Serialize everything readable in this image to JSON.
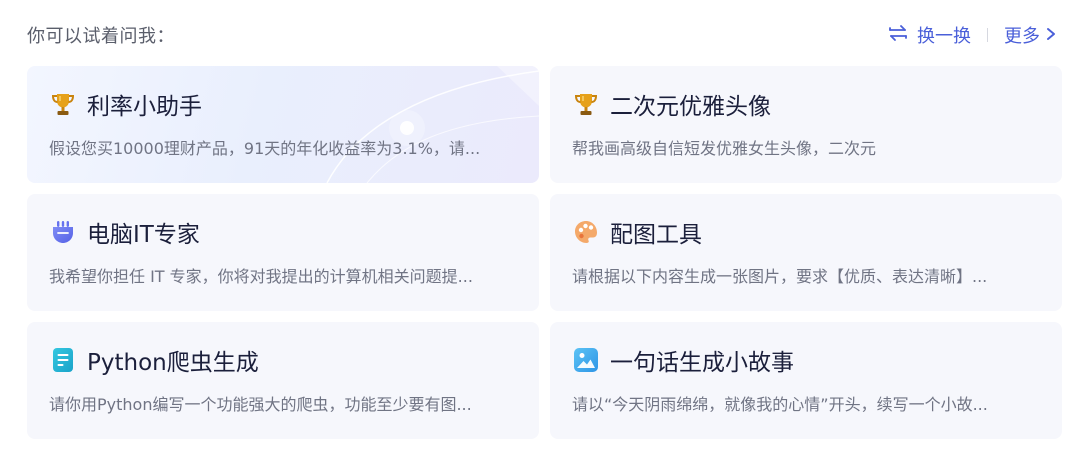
{
  "header": {
    "prompt": "你可以试着问我：",
    "swap_label": "换一换",
    "more_label": "更多"
  },
  "colors": {
    "accent": "#4a5fd9",
    "title": "#1b1f3b",
    "desc": "#707484",
    "card_bg": "#f6f7fc"
  },
  "cards": [
    {
      "icon": "trophy-icon",
      "title": "利率小助手",
      "desc": "假设您买10000理财产品，91天的年化收益率为3.1%，请..."
    },
    {
      "icon": "trophy-icon",
      "title": "二次元优雅头像",
      "desc": "帮我画高级自信短发优雅女生头像，二次元"
    },
    {
      "icon": "plug-icon",
      "title": "电脑IT专家",
      "desc": "我希望你担任 IT 专家，你将对我提出的计算机相关问题提..."
    },
    {
      "icon": "palette-icon",
      "title": "配图工具",
      "desc": "请根据以下内容生成一张图片，要求【优质、表达清晰】..."
    },
    {
      "icon": "document-icon",
      "title": "Python爬虫生成",
      "desc": "请你用Python编写一个功能强大的爬虫，功能至少要有图..."
    },
    {
      "icon": "image-icon",
      "title": "一句话生成小故事",
      "desc": "请以“今天阴雨绵绵，就像我的心情”开头，续写一个小故..."
    }
  ]
}
